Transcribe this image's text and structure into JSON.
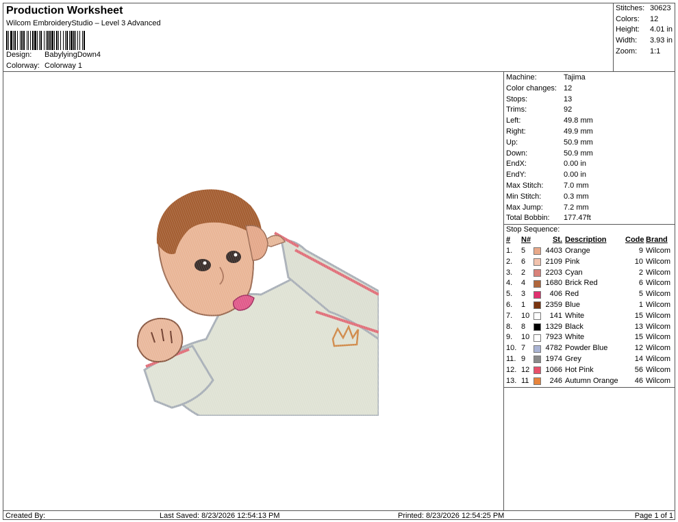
{
  "header": {
    "title": "Production Worksheet",
    "subtitle": "Wilcom EmbroideryStudio – Level 3 Advanced",
    "design_label": "Design:",
    "design_value": "BabylyingDown4",
    "colorway_label": "Colorway:",
    "colorway_value": "Colorway 1"
  },
  "summary": [
    {
      "k": "Stitches:",
      "v": "30623"
    },
    {
      "k": "Colors:",
      "v": "12"
    },
    {
      "k": "Height:",
      "v": "4.01 in"
    },
    {
      "k": "Width:",
      "v": "3.93 in"
    },
    {
      "k": "Zoom:",
      "v": "1:1"
    }
  ],
  "specs": [
    {
      "k": "Machine:",
      "v": "Tajima"
    },
    {
      "k": "Color changes:",
      "v": "12"
    },
    {
      "k": "Stops:",
      "v": "13"
    },
    {
      "k": "Trims:",
      "v": "92"
    },
    {
      "k": "Left:",
      "v": "49.8 mm"
    },
    {
      "k": "Right:",
      "v": "49.9 mm"
    },
    {
      "k": "Up:",
      "v": "50.9 mm"
    },
    {
      "k": "Down:",
      "v": "50.9 mm"
    },
    {
      "k": "EndX:",
      "v": "0.00 in"
    },
    {
      "k": "EndY:",
      "v": "0.00 in"
    },
    {
      "k": "Max Stitch:",
      "v": "7.0 mm"
    },
    {
      "k": "Min Stitch:",
      "v": "0.3 mm"
    },
    {
      "k": "Max Jump:",
      "v": "7.2 mm"
    },
    {
      "k": "Total Bobbin:",
      "v": "177.47ft"
    }
  ],
  "stop_sequence": {
    "label": "Stop Sequence:",
    "headers": {
      "num": "#",
      "n": "N#",
      "st": "St.",
      "desc": "Description",
      "code": "Code",
      "brand": "Brand"
    },
    "rows": [
      {
        "num": "1.",
        "n": "5",
        "color": "#e8a98a",
        "st": "4403",
        "desc": "Orange",
        "code": "9",
        "brand": "Wilcom"
      },
      {
        "num": "2.",
        "n": "6",
        "color": "#f2c2ad",
        "st": "2109",
        "desc": "Pink",
        "code": "10",
        "brand": "Wilcom"
      },
      {
        "num": "3.",
        "n": "2",
        "color": "#d9827a",
        "st": "2203",
        "desc": "Cyan",
        "code": "2",
        "brand": "Wilcom"
      },
      {
        "num": "4.",
        "n": "4",
        "color": "#b0663c",
        "st": "1680",
        "desc": "Brick Red",
        "code": "6",
        "brand": "Wilcom"
      },
      {
        "num": "5.",
        "n": "3",
        "color": "#e0306e",
        "st": "406",
        "desc": "Red",
        "code": "5",
        "brand": "Wilcom"
      },
      {
        "num": "6.",
        "n": "1",
        "color": "#7a3510",
        "st": "2359",
        "desc": "Blue",
        "code": "1",
        "brand": "Wilcom"
      },
      {
        "num": "7.",
        "n": "10",
        "color": "#ffffff",
        "st": "141",
        "desc": "White",
        "code": "15",
        "brand": "Wilcom"
      },
      {
        "num": "8.",
        "n": "8",
        "color": "#000000",
        "st": "1329",
        "desc": "Black",
        "code": "13",
        "brand": "Wilcom"
      },
      {
        "num": "9.",
        "n": "10",
        "color": "#ffffff",
        "st": "7923",
        "desc": "White",
        "code": "15",
        "brand": "Wilcom"
      },
      {
        "num": "10.",
        "n": "7",
        "color": "#aab4d4",
        "st": "4782",
        "desc": "Powder Blue",
        "code": "12",
        "brand": "Wilcom"
      },
      {
        "num": "11.",
        "n": "9",
        "color": "#8a8a8a",
        "st": "1974",
        "desc": "Grey",
        "code": "14",
        "brand": "Wilcom"
      },
      {
        "num": "12.",
        "n": "12",
        "color": "#e8506a",
        "st": "1066",
        "desc": "Hot Pink",
        "code": "56",
        "brand": "Wilcom"
      },
      {
        "num": "13.",
        "n": "11",
        "color": "#e8843c",
        "st": "246",
        "desc": "Autumn Orange",
        "code": "46",
        "brand": "Wilcom"
      }
    ]
  },
  "footer": {
    "created": "Created By:",
    "saved": "Last Saved: 8/23/2026 12:54:13 PM",
    "printed": "Printed: 8/23/2026 12:54:25 PM",
    "page": "Page 1 of 1"
  }
}
